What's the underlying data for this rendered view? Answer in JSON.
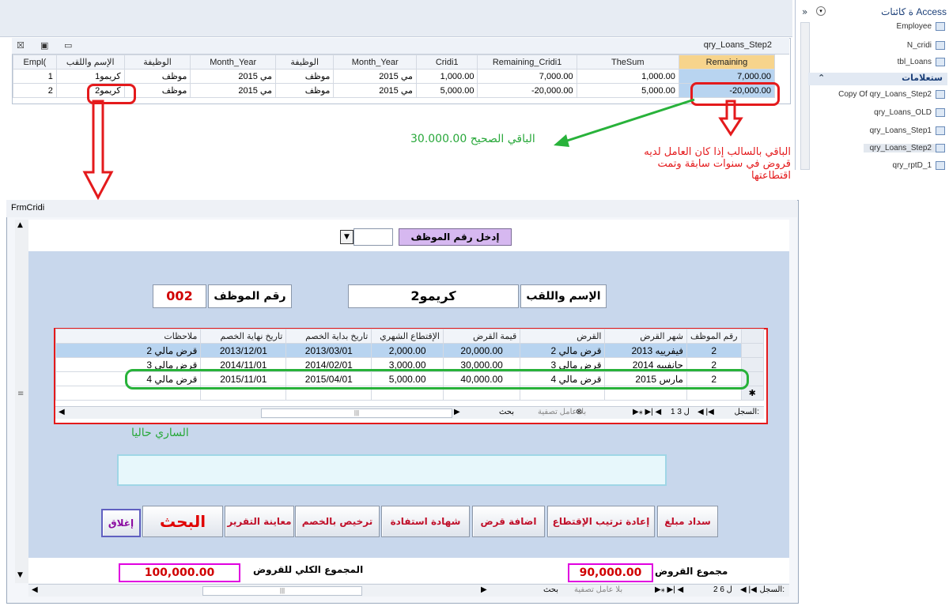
{
  "query": {
    "title": "qry_Loans_Step2",
    "columns": [
      "Empl(",
      "الإسم واللقب",
      "الوظيفة",
      "Month_Year",
      "الوظيفة",
      "Month_Year",
      "Cridi1",
      "Remaining_Cridi1",
      "TheSum",
      "Remaining"
    ],
    "rows": [
      [
        "1",
        "كريمو1",
        "موظف",
        "مي 2015",
        "موظف",
        "مي 2015",
        "1,000.00",
        "7,000.00",
        "1,000.00",
        "7,000.00"
      ],
      [
        "2",
        "كريمو2",
        "موظف",
        "مي 2015",
        "موظف",
        "مي 2015",
        "5,000.00",
        "-20,000.00",
        "5,000.00",
        "-20,000.00"
      ]
    ]
  },
  "nav": {
    "header": "ة كائنات Access",
    "tables": [
      "Employee",
      "N_cridi",
      "tbl_Loans"
    ],
    "section": "ستعلامات",
    "queries": [
      "Copy Of qry_Loans_Step2",
      "qry_Loans_OLD",
      "qry_Loans_Step1",
      "qry_Loans_Step2",
      "qry_rptD_1"
    ]
  },
  "annotations": {
    "correct_remaining": "30.000.00 الباقي الصحيح",
    "negative_note_1": "الباقي بالسالب إذا كان العامل لديه",
    "negative_note_2": "قروض في سنوات سابقة وتمت",
    "negative_note_3": "اقتطاعتها",
    "current": "الساري حاليا"
  },
  "form": {
    "title": "FrmCridi",
    "enter_emp_label": "إدخل رقم الموظف",
    "emp_no_label": "رقم الموظف",
    "emp_no_value": "002",
    "name_label": "الإسم واللقب",
    "name_value": "كريمو2",
    "sub_columns": [
      "رقم الموظف",
      "شهر القرض",
      "القرض",
      "قيمة القرض",
      "الإقتطاع الشهري",
      "تاريخ بداية الخصم",
      "تاريخ نهاية الخصم",
      "ملاحظات"
    ],
    "sub_rows": [
      [
        "2",
        "فيفرييه 2013",
        "قرض مالي 2",
        "20,000.00",
        "2,000.00",
        "2013/03/01",
        "2013/12/01",
        "قرض مالي 2"
      ],
      [
        "2",
        "جانفييه 2014",
        "قرض مالي 3",
        "30,000.00",
        "3,000.00",
        "2014/02/01",
        "2014/11/01",
        "قرض مالي 3"
      ],
      [
        "2",
        "مارس 2015",
        "قرض مالي 4",
        "40,000.00",
        "5,000.00",
        "2015/04/01",
        "2015/11/01",
        "قرض مالي 4"
      ]
    ],
    "sub_nav": {
      "record": "السجل:",
      "pos": "1 ل 3",
      "nofilter": "بلا عامل تصفية",
      "search": "بحث"
    },
    "buttons": [
      "سداد مبلغ",
      "إعادة ترتيب الإقتطاع",
      "اضافة قرض",
      "شهادة استفادة",
      "ترخيص بالخصم",
      "معاينة التقرير",
      "البحث",
      "إغلاق"
    ],
    "sum_loans_label": "مجموع القروض",
    "sum_loans_value": "90,000.00",
    "total_loans_label": "المجموع الكلي للقروض",
    "total_loans_value": "100,000.00",
    "main_nav": {
      "record": "السجل:",
      "pos": "2 ل 6",
      "nofilter": "بلا عامل تصفية",
      "search": "بحث"
    }
  },
  "colors": {
    "annotation_red": "#e41a1c",
    "annotation_green": "#28b23a",
    "highlight_magenta": "#e000e0"
  }
}
